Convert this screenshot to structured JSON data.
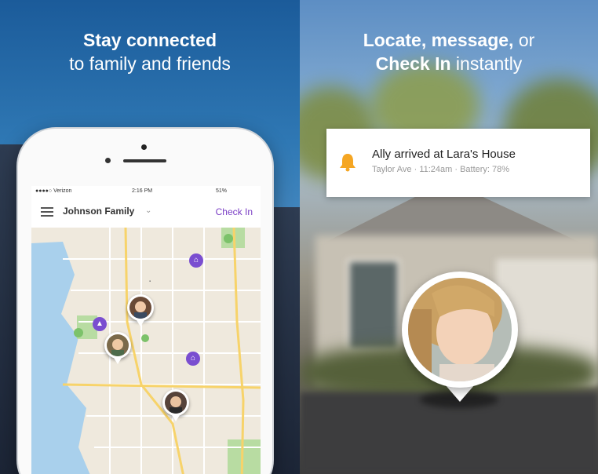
{
  "left_panel": {
    "headline_line1": "Stay connected",
    "headline_line2": "to family and friends"
  },
  "phone": {
    "status": {
      "carrier": "●●●●○ Verizon",
      "time": "2:16 PM",
      "battery": "51%"
    },
    "nav": {
      "group_name": "Johnson Family",
      "group_caret": "⌄",
      "check_in": "Check In"
    },
    "icons": [
      "menu-icon",
      "school-icon",
      "home-icon",
      "place-icon",
      "bell-icon"
    ]
  },
  "right_panel": {
    "headline_line1_bold": "Locate, message,",
    "headline_line1_rest": " or",
    "headline_line2_bold": "Check In",
    "headline_line2_rest": " instantly",
    "notification": {
      "title": "Ally arrived at Lara's House",
      "subtitle": "Taylor Ave · 11:24am · Battery: 78%"
    }
  },
  "colors": {
    "accent_purple": "#7a3ec5",
    "bell_orange": "#f5a623"
  }
}
